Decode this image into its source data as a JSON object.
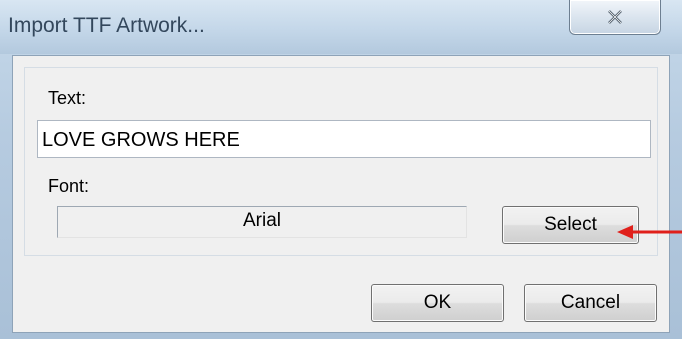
{
  "dialog": {
    "title": "Import TTF Artwork...",
    "close_icon": "close-icon",
    "text_label": "Text:",
    "text_value": "LOVE GROWS HERE",
    "font_label": "Font:",
    "font_value": "Arial",
    "select_label": "Select",
    "ok_label": "OK",
    "cancel_label": "Cancel"
  },
  "annotation": {
    "arrow_icon": "red-arrow-icon",
    "arrow_color": "#e0201b"
  },
  "colors": {
    "title_bar": "#c4d7e9",
    "client_bg": "#f0f0f0"
  }
}
